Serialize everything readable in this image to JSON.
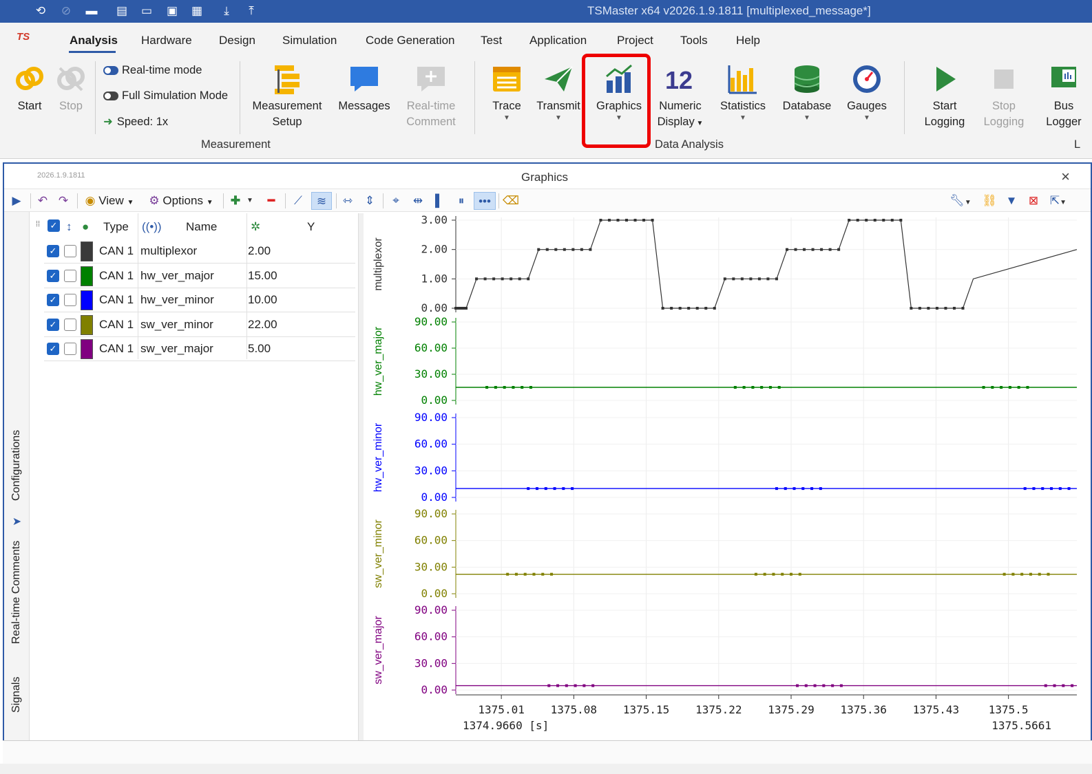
{
  "window": {
    "title": "TSMaster x64 v2026.1.9.1811 [multiplexed_message*]"
  },
  "menu": {
    "logo": "TS",
    "items": [
      "Analysis",
      "Hardware",
      "Design",
      "Simulation",
      "Code Generation",
      "Test",
      "Application",
      "Project",
      "Tools",
      "Help"
    ],
    "active": "Analysis"
  },
  "ribbon": {
    "start": "Start",
    "stop": "Stop",
    "realtime_mode": "Real-time mode",
    "full_sim": "Full Simulation Mode",
    "speed": "Speed: 1x",
    "measurement_setup": [
      "Measurement",
      "Setup"
    ],
    "messages": "Messages",
    "realtime_comment": [
      "Real-time",
      "Comment"
    ],
    "group_measurement": "Measurement",
    "trace": "Trace",
    "transmit": "Transmit",
    "graphics": "Graphics",
    "numeric_display": [
      "Numeric",
      "Display"
    ],
    "statistics": "Statistics",
    "database": "Database",
    "gauges": "Gauges",
    "group_data_analysis": "Data Analysis",
    "start_logging": [
      "Start",
      "Logging"
    ],
    "stop_logging": [
      "Stop",
      "Logging"
    ],
    "bus_logger": [
      "Bus",
      "Logger"
    ],
    "group_logging_partial": "L"
  },
  "panel": {
    "version": "2026.1.9.1811",
    "title": "Graphics",
    "close": "×",
    "view_label": "View",
    "options_label": "Options"
  },
  "side_tabs": {
    "configurations": "Configurations",
    "comments": "Real-time Comments",
    "signals": "Signals"
  },
  "grid": {
    "headers": {
      "type": "Type",
      "name": "Name",
      "y": "Y"
    },
    "rows": [
      {
        "type": "CAN 1",
        "name": "multiplexor",
        "y": "2.00",
        "color": "#3a3a3a"
      },
      {
        "type": "CAN 1",
        "name": "hw_ver_major",
        "y": "15.00",
        "color": "#008000"
      },
      {
        "type": "CAN 1",
        "name": "hw_ver_minor",
        "y": "10.00",
        "color": "#0000ff"
      },
      {
        "type": "CAN 1",
        "name": "sw_ver_minor",
        "y": "22.00",
        "color": "#808000"
      },
      {
        "type": "CAN 1",
        "name": "sw_ver_major",
        "y": "5.00",
        "color": "#800080"
      }
    ]
  },
  "chart_data": {
    "type": "line",
    "x_start_label": "1374.9660 [s]",
    "x_end_label": "1375.5661",
    "xlim": [
      1374.966,
      1375.5661
    ],
    "x_ticks": [
      "1375.01",
      "1375.08",
      "1375.15",
      "1375.22",
      "1375.29",
      "1375.36",
      "1375.43",
      "1375.5"
    ],
    "x_tick_values": [
      1375.01,
      1375.08,
      1375.15,
      1375.22,
      1375.29,
      1375.36,
      1375.43,
      1375.5
    ],
    "series": [
      {
        "name": "multiplexor",
        "color": "#333333",
        "y_ticks": [
          "3.00",
          "2.00",
          "1.00",
          "0.00"
        ],
        "ylim": [
          0,
          3
        ],
        "x": [
          1374.966,
          1374.976,
          1374.986,
          1375.036,
          1375.046,
          1375.096,
          1375.106,
          1375.156,
          1375.166,
          1375.216,
          1375.226,
          1375.276,
          1375.286,
          1375.336,
          1375.346,
          1375.396,
          1375.406,
          1375.456,
          1375.466,
          1375.5661
        ],
        "values": [
          0,
          0,
          1,
          1,
          2,
          2,
          3,
          3,
          0,
          0,
          1,
          1,
          2,
          2,
          3,
          3,
          0,
          0,
          1,
          2
        ]
      },
      {
        "name": "hw_ver_major",
        "color": "#008000",
        "y_ticks": [
          "90.00",
          "60.00",
          "30.00",
          "0.00"
        ],
        "ylim": [
          0,
          90
        ],
        "values_const": 15
      },
      {
        "name": "hw_ver_minor",
        "color": "#0000ff",
        "y_ticks": [
          "90.00",
          "60.00",
          "30.00",
          "0.00"
        ],
        "ylim": [
          0,
          90
        ],
        "values_const": 10
      },
      {
        "name": "sw_ver_minor",
        "color": "#808000",
        "y_ticks": [
          "90.00",
          "60.00",
          "30.00",
          "0.00"
        ],
        "ylim": [
          0,
          90
        ],
        "values_const": 22
      },
      {
        "name": "sw_ver_major",
        "color": "#800080",
        "y_ticks": [
          "90.00",
          "60.00",
          "30.00",
          "0.00"
        ],
        "ylim": [
          0,
          90
        ],
        "values_const": 5
      }
    ]
  }
}
